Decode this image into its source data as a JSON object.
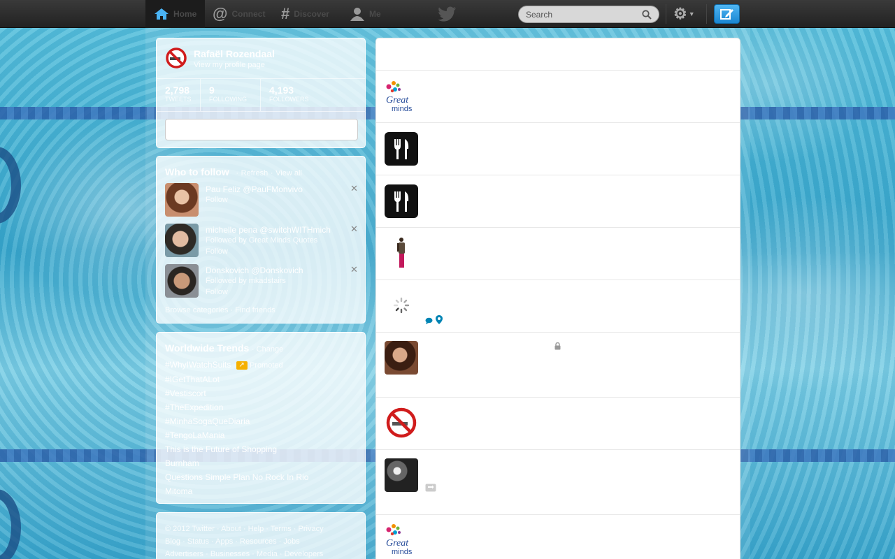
{
  "nav": {
    "home": "Home",
    "connect": "Connect",
    "discover": "Discover",
    "me": "Me"
  },
  "search": {
    "placeholder": "Search"
  },
  "profile": {
    "name": "Rafaël Rozendaal",
    "link": "View my profile page",
    "stats": [
      {
        "value": "2,798",
        "label": "TWEETS"
      },
      {
        "value": "9",
        "label": "FOLLOWING"
      },
      {
        "value": "4,193",
        "label": "FOLLOWERS"
      }
    ]
  },
  "who_to_follow": {
    "title": "Who to follow",
    "refresh": "Refresh",
    "view_all": "View all",
    "users": [
      {
        "name": "Pau Feliz @PauFMonvivo",
        "line2": "",
        "follow": "Follow",
        "avatar_color": "#8a5a3c"
      },
      {
        "name": "michelle pena @switchWITHmich",
        "line2": "Followed by Great Minds Quotes",
        "follow": "Follow",
        "avatar_color": "#5b7a8a"
      },
      {
        "name": "Donskovich @Donskovich",
        "line2": "Followed by mkadstairs",
        "follow": "Follow",
        "avatar_color": "#4a4036"
      }
    ],
    "footer": "Browse categories · Find friends"
  },
  "trends": {
    "title": "Worldwide Trends",
    "change": "· Change",
    "promoted": "Promoted",
    "items": [
      "#WhyIWatchSuits",
      "#IGetThatALot",
      "#Vestiscort",
      "#TheExpedition",
      "#MinhaSogaQueDiaria",
      "#TengoLaMania",
      "This is the Future of Shopping",
      "Burnham",
      "Questions Simple Plan No Rock In Rio",
      "Mitoma"
    ]
  },
  "footer": {
    "line1": [
      "© 2012 Twitter",
      "About",
      "Help",
      "Terms",
      "Privacy"
    ],
    "line2": [
      "Blog",
      "Status",
      "Apps",
      "Resources",
      "Jobs"
    ],
    "line3": [
      "Advertisers",
      "Businesses",
      "Media",
      "Developers"
    ]
  },
  "colors": {
    "accent": "#1b95e0",
    "topbar": "#2a2a2a",
    "tweet_action": "#0084b4"
  }
}
